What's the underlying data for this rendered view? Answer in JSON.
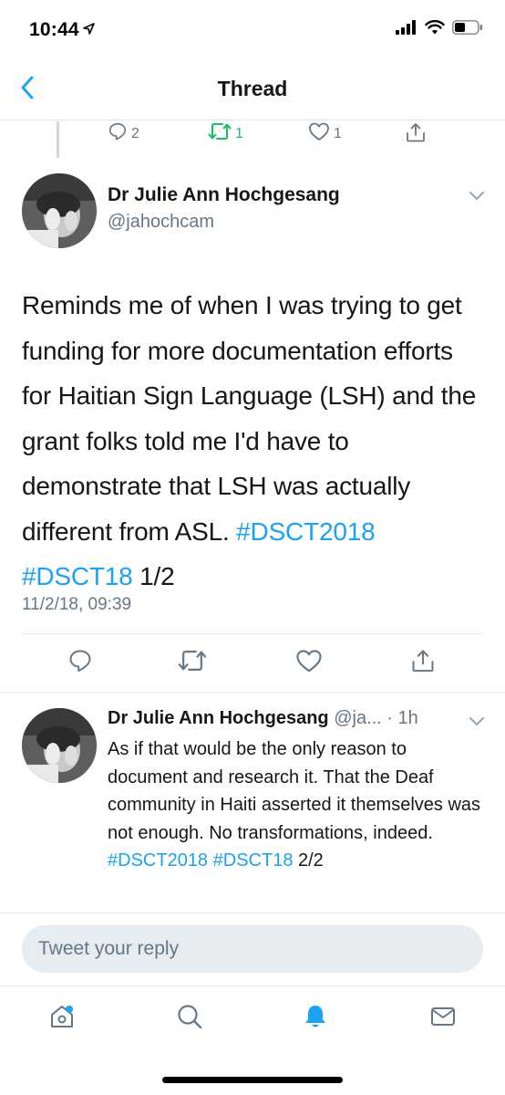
{
  "status_bar": {
    "time": "10:44"
  },
  "nav": {
    "title": "Thread"
  },
  "previous_tweet_actions": {
    "replies": "2",
    "retweets": "1",
    "likes": "1"
  },
  "main_tweet": {
    "author_name": "Dr Julie Ann Hochgesang",
    "author_handle": "@jahochcam",
    "text_plain": "Reminds me of when I was trying to get funding for more documentation efforts for Haitian Sign Language (LSH) and the grant folks told me I'd have to demonstrate that LSH was actually different from ASL. ",
    "hashtag_1": "#DSCT2018",
    "hashtag_2": "#DSCT18",
    "text_suffix": " 1/2",
    "timestamp": "11/2/18, 09:39"
  },
  "reply_tweet": {
    "author_name": "Dr Julie Ann Hochgesang",
    "handle_truncated": "@ja...",
    "age": "1h",
    "text_plain": "As if that would be the only reason to document and research it. That the Deaf community in Haiti asserted it themselves was not enough. No transformations, indeed. ",
    "hashtag_1": "#DSCT2018",
    "hashtag_2": "#DSCT18",
    "text_suffix": " 2/2"
  },
  "compose": {
    "placeholder": "Tweet your reply"
  },
  "colors": {
    "accent": "#1da1f2",
    "retweet_green": "#17bf63",
    "secondary_text": "#657786",
    "divider": "#e1e8ed"
  },
  "icons": [
    "location-arrow-icon",
    "signal-icon",
    "wifi-icon",
    "battery-icon",
    "back-chevron-icon",
    "reply-icon",
    "retweet-icon",
    "like-icon",
    "share-icon",
    "chevron-down-icon",
    "home-icon",
    "search-icon",
    "notifications-icon",
    "messages-icon"
  ]
}
